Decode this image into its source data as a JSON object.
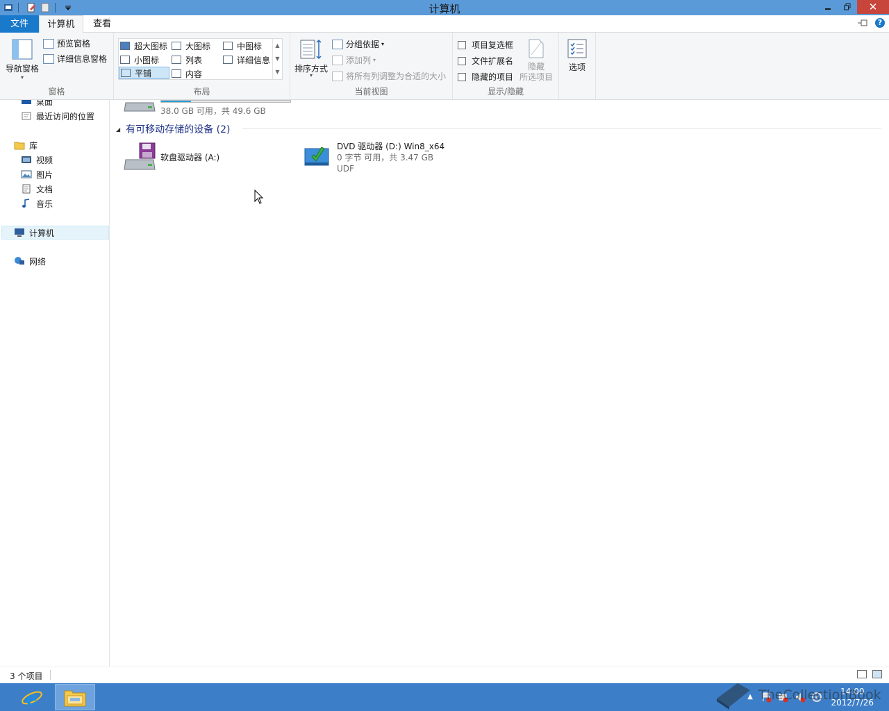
{
  "window": {
    "title": "计算机",
    "minimize_icon": "minimize-icon",
    "maximize_icon": "restore-icon",
    "close_glyph": "✕"
  },
  "tabs": {
    "file": "文件",
    "computer": "计算机",
    "view": "查看"
  },
  "ribbon": {
    "panes": {
      "nav_pane": "导航窗格",
      "preview_pane": "预览窗格",
      "details_pane": "详细信息窗格",
      "label": "窗格"
    },
    "layout": {
      "extra_large": "超大图标",
      "large": "大图标",
      "medium": "中图标",
      "small": "小图标",
      "list": "列表",
      "details": "详细信息",
      "tiles": "平铺",
      "content": "内容",
      "label": "布局",
      "selected": "平铺"
    },
    "current_view": {
      "sort_by": "排序方式",
      "group_by": "分组依据",
      "add_columns": "添加列",
      "size_all_columns": "将所有列调整为合适的大小",
      "label": "当前视图"
    },
    "show_hide": {
      "item_checkboxes": "项目复选框",
      "file_extensions": "文件扩展名",
      "hidden_items": "隐藏的项目",
      "hide_selected_1": "隐藏",
      "hide_selected_2": "所选项目",
      "label": "显示/隐藏"
    },
    "options": "选项"
  },
  "nav": {
    "desktop": "桌面",
    "recent": "最近访问的位置",
    "libraries": "库",
    "videos": "视频",
    "pictures": "图片",
    "documents": "文档",
    "music": "音乐",
    "computer": "计算机",
    "network": "网络"
  },
  "content": {
    "drive_c": {
      "free_text": "38.0 GB 可用，共 49.6 GB",
      "used_fraction": 0.23
    },
    "section_removable": "有可移动存储的设备 (2)",
    "floppy": {
      "name": "软盘驱动器 (A:)"
    },
    "dvd": {
      "name": "DVD 驱动器 (D:) Win8_x64",
      "free_text": "0 字节 可用，共 3.47 GB",
      "fs": "UDF"
    }
  },
  "status": {
    "count": "3 个项目"
  },
  "taskbar": {
    "time": "14:00",
    "date": "2012/7/26"
  },
  "watermark": "TheCollectionBook",
  "colors": {
    "titlebar": "#5b9ad8",
    "file_tab": "#1979ca",
    "taskbar": "#3c7ec8",
    "section_heading": "#1e3287",
    "progress_fill": "#26a0da"
  }
}
